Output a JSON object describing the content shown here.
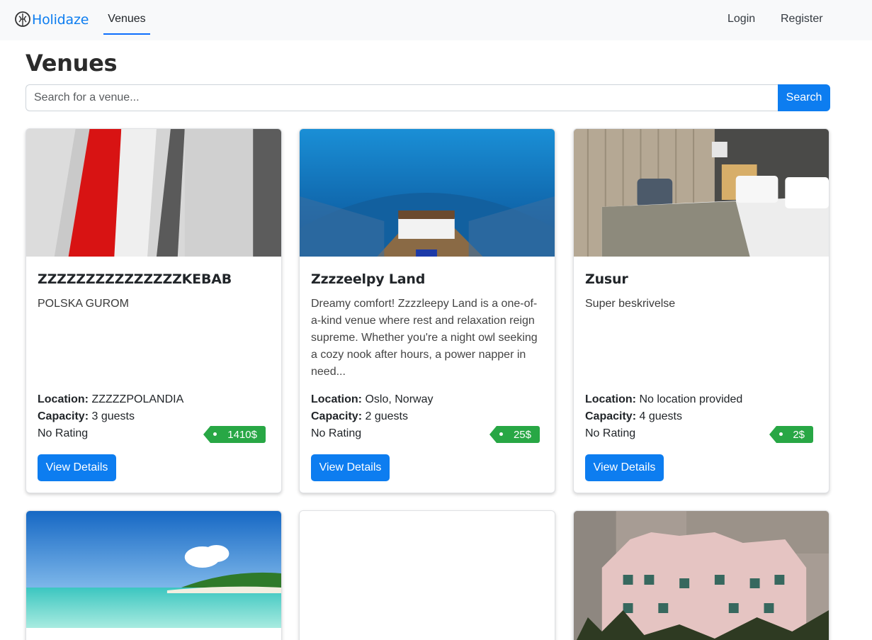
{
  "navbar": {
    "brand": "Holidaze",
    "active_link": "Venues",
    "login": "Login",
    "register": "Register"
  },
  "page": {
    "title": "Venues"
  },
  "search": {
    "placeholder": "Search for a venue...",
    "button": "Search"
  },
  "labels": {
    "location": "Location:",
    "capacity": "Capacity:",
    "view_details": "View Details"
  },
  "venues": [
    {
      "name": "ZZZZZZZZZZZZZZZKEBAB",
      "description": "POLSKA GUROM",
      "location": "ZZZZZPOLANDIA",
      "capacity": "3 guests",
      "rating": "No Rating",
      "price": "1410$"
    },
    {
      "name": "Zzzzeelpy Land",
      "description": "Dreamy comfort! Zzzzleepy Land is a one-of-a-kind venue where rest and relaxation reign supreme. Whether you're a night owl seeking a cozy nook after hours, a power napper in need...",
      "location": "Oslo, Norway",
      "capacity": "2 guests",
      "rating": "No Rating",
      "price": "25$"
    },
    {
      "name": "Zusur",
      "description": "Super beskrivelse",
      "location": "No location provided",
      "capacity": "4 guests",
      "rating": "No Rating",
      "price": "2$"
    }
  ],
  "colors": {
    "primary": "#0d7df0",
    "price_badge": "#28a745",
    "navbar_bg": "#f8f9fa"
  }
}
